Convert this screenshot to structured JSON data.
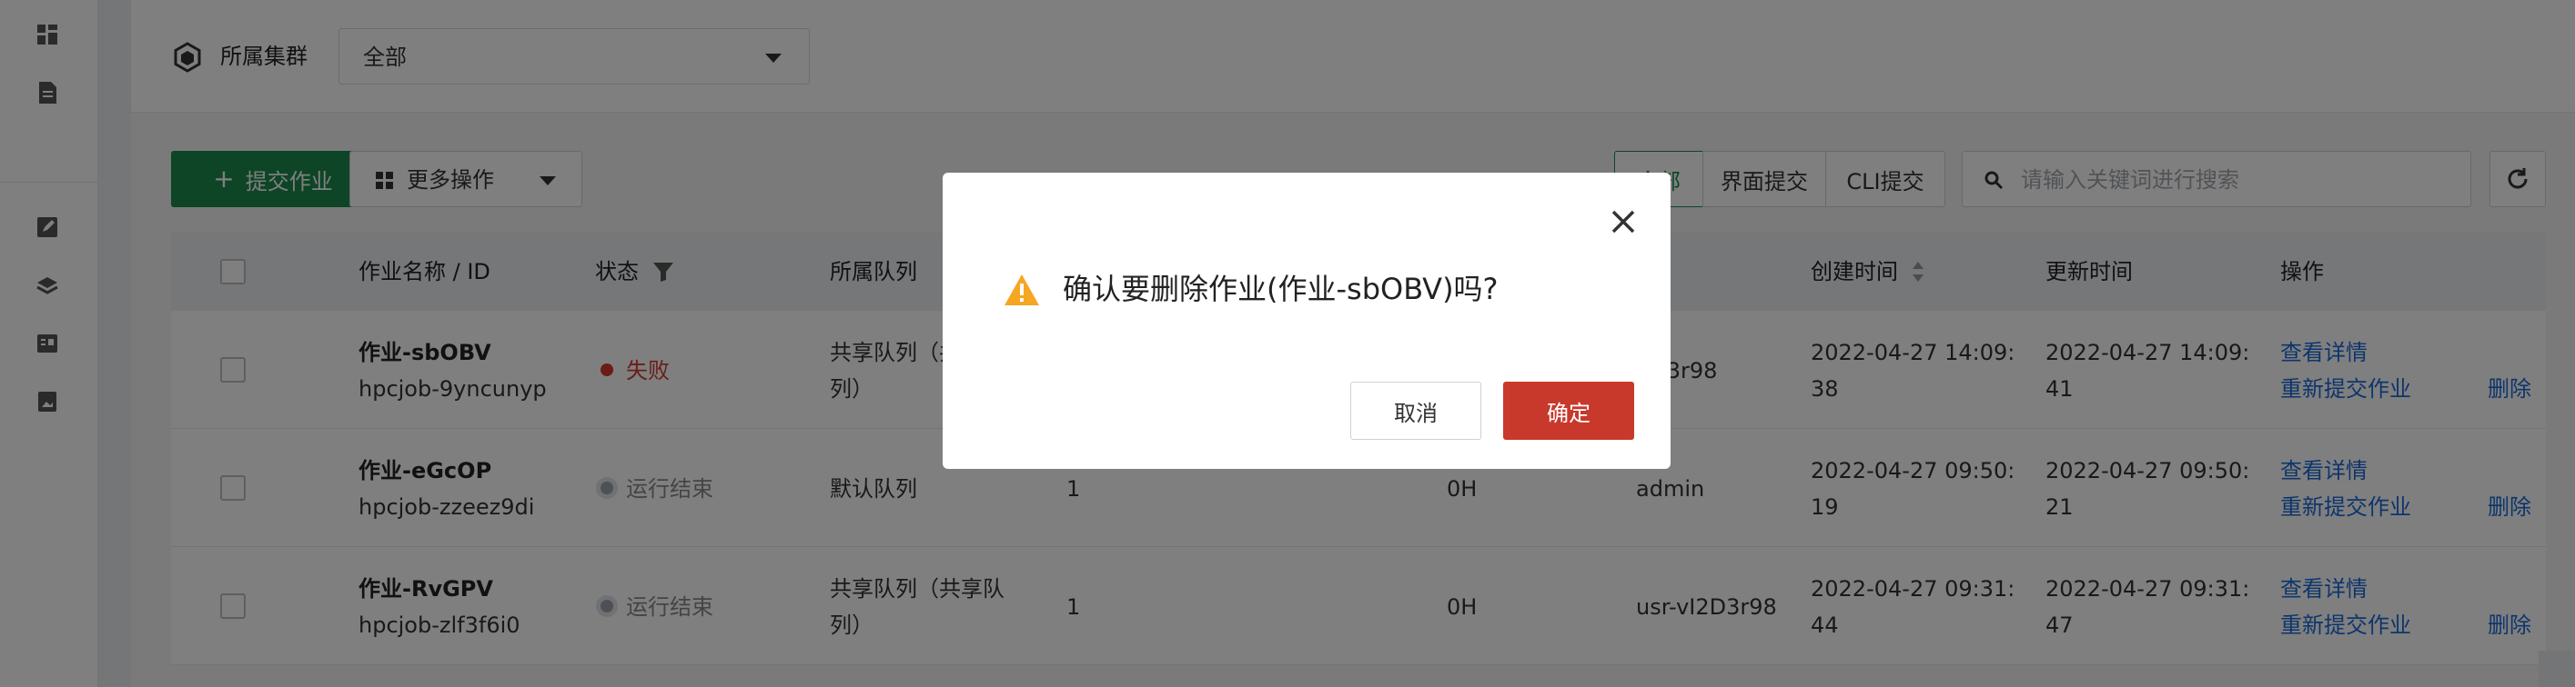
{
  "filter": {
    "cluster_label": "所属集群",
    "cluster_value": "全部"
  },
  "toolbar": {
    "submit_label": "提交作业",
    "submit_icon": "plus-icon",
    "more_label": "更多操作",
    "segments": [
      "全部",
      "界面提交",
      "CLI提交"
    ],
    "search_placeholder": "请输入关键词进行搜索"
  },
  "table": {
    "headers": {
      "name": "作业名称 / ID",
      "status": "状态",
      "queue": "所属队列",
      "created": "创建时间",
      "updated": "更新时间",
      "actions": "操作"
    },
    "rows": [
      {
        "name": "作业-sbOBV",
        "id": "hpcjob-9yncunyp",
        "status": "失败",
        "status_type": "fail",
        "queue_line1": "共享队列（共享",
        "queue_line2": "列）",
        "count": "",
        "duration": "",
        "user": "usr-vI2D3r98",
        "user_visible": "2D3r98",
        "created_line1": "2022-04-27 14:09:",
        "created_line2": "38",
        "updated_line1": "2022-04-27 14:09:",
        "updated_line2": "41",
        "action_view": "查看详情",
        "action_resubmit": "重新提交作业",
        "action_delete": "删除"
      },
      {
        "name": "作业-eGcOP",
        "id": "hpcjob-zzeez9di",
        "status": "运行结束",
        "status_type": "done",
        "queue_line1": "默认队列",
        "queue_line2": "",
        "count": "1",
        "duration": "0H",
        "user": "admin",
        "created_line1": "2022-04-27 09:50:",
        "created_line2": "19",
        "updated_line1": "2022-04-27 09:50:",
        "updated_line2": "21",
        "action_view": "查看详情",
        "action_resubmit": "重新提交作业",
        "action_delete": "删除"
      },
      {
        "name": "作业-RvGPV",
        "id": "hpcjob-zlf3f6i0",
        "status": "运行结束",
        "status_type": "done",
        "queue_line1": "共享队列（共享队",
        "queue_line2": "列）",
        "count": "1",
        "duration": "0H",
        "user": "usr-vI2D3r98",
        "created_line1": "2022-04-27 09:31:",
        "created_line2": "44",
        "updated_line1": "2022-04-27 09:31:",
        "updated_line2": "47",
        "action_view": "查看详情",
        "action_resubmit": "重新提交作业",
        "action_delete": "删除"
      }
    ]
  },
  "modal": {
    "title": "确认要删除作业(作业-sbOBV)吗?",
    "cancel_label": "取消",
    "confirm_label": "确定"
  },
  "colors": {
    "primary_green": "#1b8a4c",
    "danger_red": "#c8392b",
    "link_blue": "#1a6ad8"
  }
}
